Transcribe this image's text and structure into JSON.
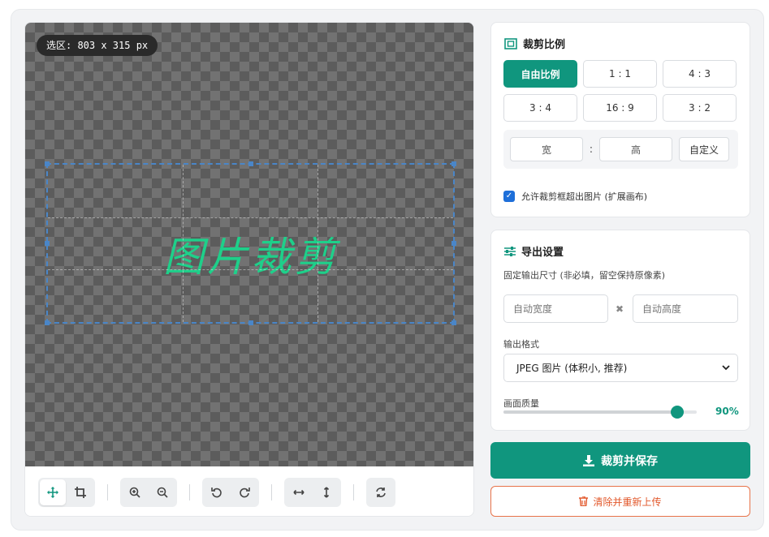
{
  "editor": {
    "selection_label": "选区: 803 x 315 px",
    "crop_text": "图片裁剪",
    "toolbar": {
      "move_icon": "move-icon",
      "crop_icon": "crop-icon",
      "zoom_in_icon": "zoom-in-icon",
      "zoom_out_icon": "zoom-out-icon",
      "rotate_left_icon": "rotate-left-icon",
      "rotate_right_icon": "rotate-right-icon",
      "flip_h_icon": "flip-horizontal-icon",
      "flip_v_icon": "flip-vertical-icon",
      "reset_icon": "reset-icon",
      "active_tool": "move"
    }
  },
  "ratio": {
    "title": "裁剪比例",
    "options": [
      "自由比例",
      "1 : 1",
      "4 : 3",
      "3 : 4",
      "16 : 9",
      "3 : 2"
    ],
    "active_index": 0,
    "custom": {
      "width_placeholder": "宽",
      "colon": ":",
      "height_placeholder": "高",
      "button": "自定义"
    },
    "allow_overflow": {
      "label": "允许裁剪框超出图片 (扩展画布)",
      "checked": true
    }
  },
  "export": {
    "title": "导出设置",
    "size_label": "固定输出尺寸 (非必填，留空保持原像素)",
    "width_placeholder": "自动宽度",
    "times": "✖",
    "height_placeholder": "自动高度",
    "format_label": "输出格式",
    "format_value": "JPEG 图片 (体积小, 推荐)",
    "quality_label": "画面质量",
    "quality_value": "90%",
    "quality_fraction": 0.9
  },
  "actions": {
    "save": "裁剪并保存",
    "clear": "清除并重新上传"
  },
  "colors": {
    "accent": "#10967e",
    "danger": "#e2582b",
    "crop_border": "#4a86c8",
    "crop_text": "#1ed08a"
  }
}
